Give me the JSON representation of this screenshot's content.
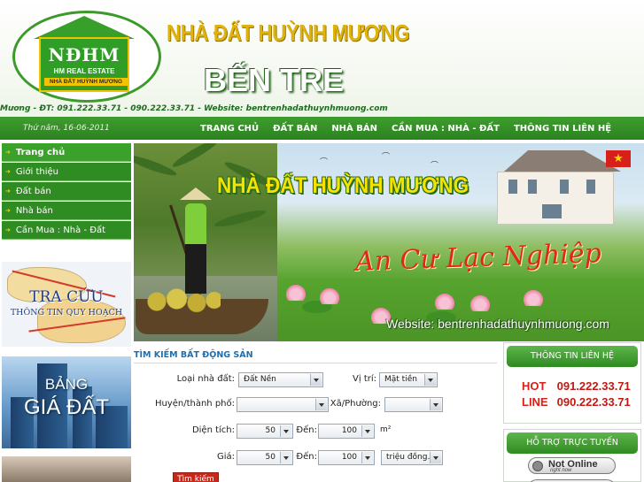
{
  "header": {
    "logo_initials": "NĐHM",
    "logo_tagline": "HM REAL ESTATE",
    "logo_name": "NHÀ ĐẤT HUỲNH MƯƠNG",
    "title": "NHÀ ĐẤT HUỲNH MƯƠNG",
    "city": "BẾN TRE",
    "contact_line": "Mương - ĐT: 091.222.33.71 - 090.222.33.71 - Website: bentrenhadathuynhmuong.com - Email: L"
  },
  "nav": {
    "date": "Thứ năm, 16-06-2011",
    "items": [
      {
        "label": "TRANG CHỦ"
      },
      {
        "label": "ĐẤT BÁN"
      },
      {
        "label": "NHÀ BÁN"
      },
      {
        "label": "CẦN MUA : NHÀ - ĐẤT"
      },
      {
        "label": "THÔNG TIN LIÊN HỆ"
      }
    ]
  },
  "sidebar": {
    "items": [
      {
        "label": "Trang chủ"
      },
      {
        "label": "Giới thiệu"
      },
      {
        "label": "Đất bán"
      },
      {
        "label": "Nhà bán"
      },
      {
        "label": "Cần Mua : Nhà - Đất"
      }
    ],
    "map_banner": {
      "title": "TRA CỨU",
      "subtitle": "THÔNG TIN QUY HOẠCH"
    },
    "price_banner": {
      "line1": "BẢNG",
      "line2": "GIÁ ĐẤT"
    }
  },
  "banner": {
    "title": "NHÀ ĐẤT HUỲNH MƯƠNG",
    "slogan": "An Cư Lạc Nghiệp",
    "website": "Website: bentrenhadathuynhmuong.com",
    "flag_star": "★"
  },
  "search": {
    "heading": "TÌM KIẾM BẤT ĐỘNG SẢN",
    "type_label": "Loại nhà đất:",
    "type_value": "Đất Nền",
    "position_label": "Vị trí:",
    "position_value": "Mặt tiền",
    "district_label": "Huyện/thành phố:",
    "district_value": "",
    "ward_label": "Xã/Phường:",
    "ward_value": "",
    "area_label": "Diện tích:",
    "area_from": "50",
    "area_to_label": "Đến:",
    "area_to": "100",
    "area_unit": "m²",
    "price_label": "Giá:",
    "price_from": "50",
    "price_to_label": "Đến:",
    "price_to": "100",
    "price_unit": "triệu đồng.",
    "button": "Tìm kiếm"
  },
  "contact_box": {
    "heading": "THÔNG TIN LIÊN HỆ",
    "rows": [
      {
        "key": "HOT",
        "number": "091.222.33.71"
      },
      {
        "key": "LINE",
        "number": "090.222.33.71"
      }
    ]
  },
  "support_box": {
    "heading": "HỖ TRỢ TRỰC TUYẾN",
    "status": "Not Online",
    "status_sub": "right now"
  },
  "colors": {
    "brand_green": "#2f8c22",
    "accent_yellow": "#e0b20a",
    "hot_red": "#d62219",
    "heading_blue": "#1f6fb0"
  }
}
